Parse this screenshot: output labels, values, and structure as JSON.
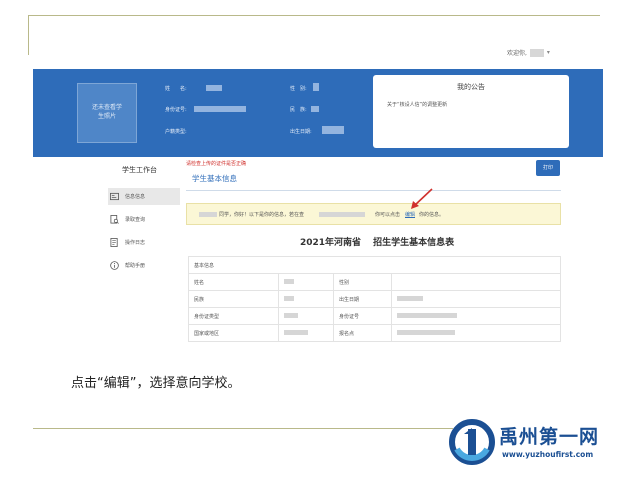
{
  "header": {
    "welcome_label": "欢迎你,"
  },
  "banner": {
    "photo_text": [
      "还未查看学",
      "生照片"
    ],
    "fields": [
      {
        "label": "姓　　名:"
      },
      {
        "label": "身份证号:"
      },
      {
        "label": "户籍类型:"
      },
      {
        "label": "性　别:"
      },
      {
        "label": "民　族:"
      },
      {
        "label": "出生日期:"
      }
    ]
  },
  "notice": {
    "title": "我的公告",
    "item": "关于“核设人信”的调整更新"
  },
  "sidebar": {
    "title": "学生工作台",
    "items": [
      {
        "label": "信息信息"
      },
      {
        "label": "录取查询"
      },
      {
        "label": "操作日志"
      },
      {
        "label": "帮助手册"
      }
    ]
  },
  "main": {
    "upload_hint": "请检查上传的证件是否正确",
    "section_title": "学生基本信息",
    "print_label": "打印",
    "tip": {
      "part1": "同学，你好！以下是你的信息，若在查",
      "part2": "你可以点击",
      "edit_link": "编辑",
      "part3": "你的信息。"
    },
    "form_title_left": "2021年河南省",
    "form_title_right": "招生学生基本信息表",
    "table": {
      "section": "基本信息",
      "rows": [
        {
          "l1": "姓名",
          "l2": "性别"
        },
        {
          "l1": "民族",
          "l2": "出生日期"
        },
        {
          "l1": "身份证类型",
          "l2": "身份证号"
        },
        {
          "l1": "国家或地区",
          "l2": "报名点"
        }
      ]
    }
  },
  "caption": "点击“编辑”，选择意向学校。",
  "logo": {
    "title": "禹州第一网",
    "url": "www.yuzhoufirst.com"
  },
  "colors": {
    "banner_blue": "#2e6cb9",
    "logo_blue": "#1b4f93",
    "hint_red": "#d0312d",
    "tip_yellow": "#fbf7d6"
  }
}
